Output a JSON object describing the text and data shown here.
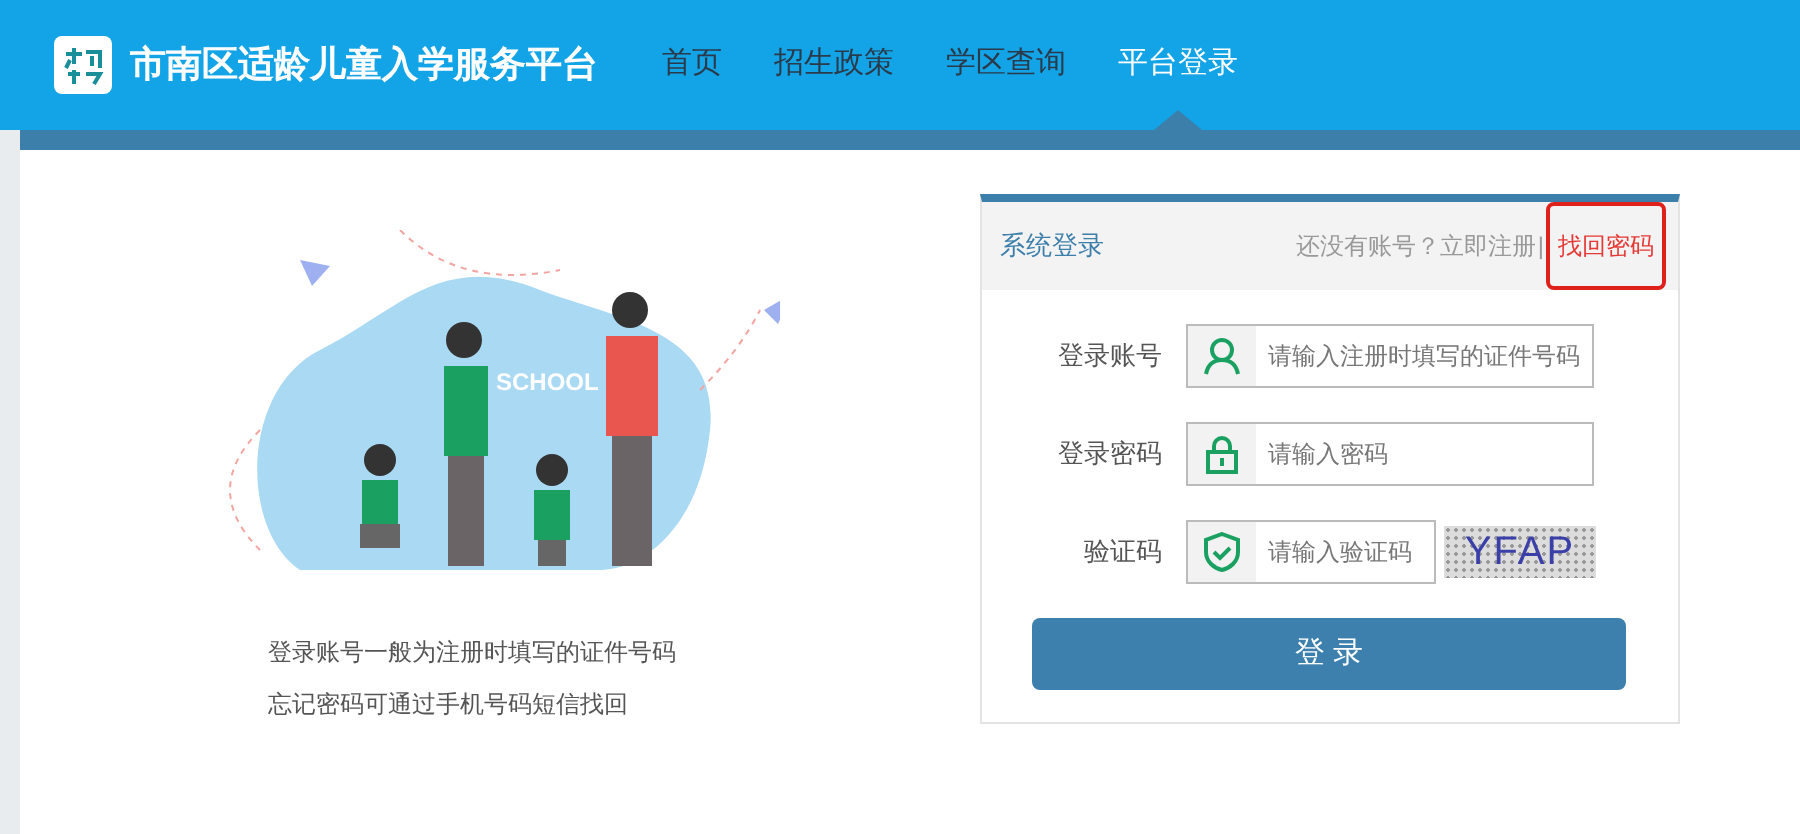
{
  "header": {
    "title": "市南区适龄儿童入学服务平台",
    "nav": [
      {
        "label": "首页",
        "selected": false
      },
      {
        "label": "招生政策",
        "selected": false
      },
      {
        "label": "学区查询",
        "selected": false
      },
      {
        "label": "平台登录",
        "selected": true
      }
    ]
  },
  "illustration": {
    "label": "SCHOOL"
  },
  "hints": [
    "登录账号一般为注册时填写的证件号码",
    "忘记密码可通过手机号码短信找回"
  ],
  "login": {
    "title": "系统登录",
    "register_prompt": "还没有账号？立即注册",
    "separator": "|",
    "recover_link": {
      "label": "找回密码",
      "highlighted": true
    },
    "fields": [
      {
        "kind": "user",
        "label": "登录账号",
        "placeholder": "请输入注册时填写的证件号码"
      },
      {
        "kind": "lock",
        "label": "登录密码",
        "placeholder": "请输入密码"
      },
      {
        "kind": "captcha",
        "label": "验证码",
        "placeholder": "请输入验证码",
        "captcha": "YFAP"
      }
    ],
    "submit": "登 录"
  }
}
